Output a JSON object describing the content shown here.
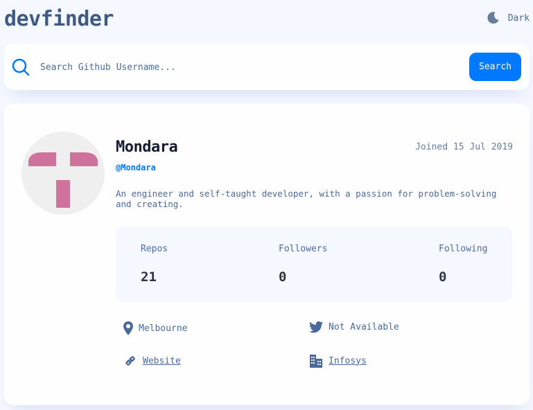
{
  "app": {
    "title": "devfinder",
    "theme_toggle_label": "Dark",
    "accent_color": "#0079ff"
  },
  "search": {
    "placeholder": "Search Github Username...",
    "value": "",
    "button_label": "Search"
  },
  "profile": {
    "name": "Mondara",
    "login": "@Mondara",
    "joined": "Joined 15 Jul 2019",
    "bio": "An engineer and self-taught developer, with a passion for problem-solving and creating.",
    "avatar_icon": "identicon-avatar",
    "stats": {
      "repos_label": "Repos",
      "repos_value": "21",
      "followers_label": "Followers",
      "followers_value": "0",
      "following_label": "Following",
      "following_value": "0"
    },
    "links": {
      "location": "Melbourne",
      "twitter": "Not Available",
      "website": "Website",
      "company": "Infosys"
    },
    "icons": {
      "location": "location-pin-icon",
      "twitter": "twitter-icon",
      "website": "link-icon",
      "company": "building-icon"
    }
  }
}
